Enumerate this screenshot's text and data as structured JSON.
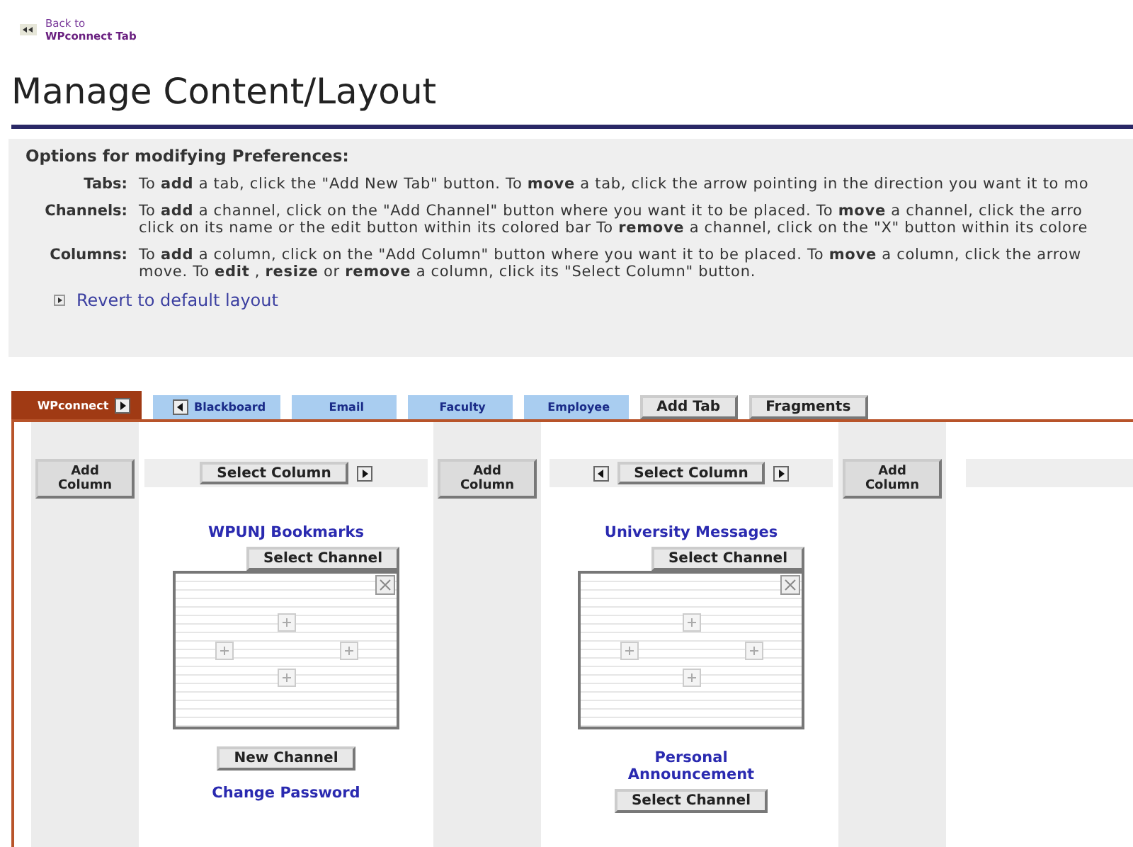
{
  "back_link": {
    "line_1": "Back to",
    "line_2": "WPconnect Tab"
  },
  "title": "Manage Content/Layout",
  "options": {
    "heading": "Options for modifying Preferences:",
    "items": [
      {
        "label": "Tabs:",
        "lines": [
          "To **add** a tab, click the \"Add New Tab\" button. To **move** a tab, click the arrow pointing in the direction you want it to mo"
        ]
      },
      {
        "label": "Channels:",
        "lines": [
          "To **add** a channel, click on the \"Add Channel\" button where you want it to be placed. To **move** a channel, click the arro",
          "click on its name or the edit button within its colored bar To **remove** a channel, click on the \"X\" button within its colore"
        ]
      },
      {
        "label": "Columns:",
        "lines": [
          "To **add** a column, click on the \"Add Column\" button where you want it to be placed. To **move** a column, click the arrow",
          "move. To **edit** , **resize** or **remove** a column, click its \"Select Column\" button."
        ]
      }
    ],
    "revert_link": "Revert to default layout"
  },
  "tabs": [
    {
      "label": "WPconnect",
      "selected": true,
      "move_left": false,
      "move_right": true
    },
    {
      "label": "Blackboard",
      "selected": false,
      "move_left": true,
      "move_right": false
    },
    {
      "label": "Email",
      "selected": false,
      "move_left": false,
      "move_right": false
    },
    {
      "label": "Faculty",
      "selected": false,
      "move_left": false,
      "move_right": false
    },
    {
      "label": "Employee",
      "selected": false,
      "move_left": false,
      "move_right": false
    }
  ],
  "tab_buttons": [
    "Add Tab",
    "Fragments"
  ],
  "columns": [
    {
      "kind": "add",
      "label": "Add Column"
    },
    {
      "kind": "content",
      "select_label": "Select Column",
      "move_left": false,
      "move_right": true,
      "items": [
        {
          "kind": "channel",
          "title": "WPUNJ Bookmarks",
          "select_label": "Select Channel"
        },
        {
          "kind": "new",
          "label": "New Channel"
        },
        {
          "kind": "title",
          "title": "Change Password"
        }
      ]
    },
    {
      "kind": "add",
      "label": "Add Column"
    },
    {
      "kind": "content",
      "select_label": "Select Column",
      "move_left": true,
      "move_right": true,
      "items": [
        {
          "kind": "channel",
          "title": "University Messages",
          "select_label": "Select Channel"
        },
        {
          "kind": "header",
          "title": "Personal Announcement",
          "select_label": "Select Channel"
        }
      ]
    },
    {
      "kind": "add",
      "label": "Add Column"
    },
    {
      "kind": "filler"
    }
  ]
}
